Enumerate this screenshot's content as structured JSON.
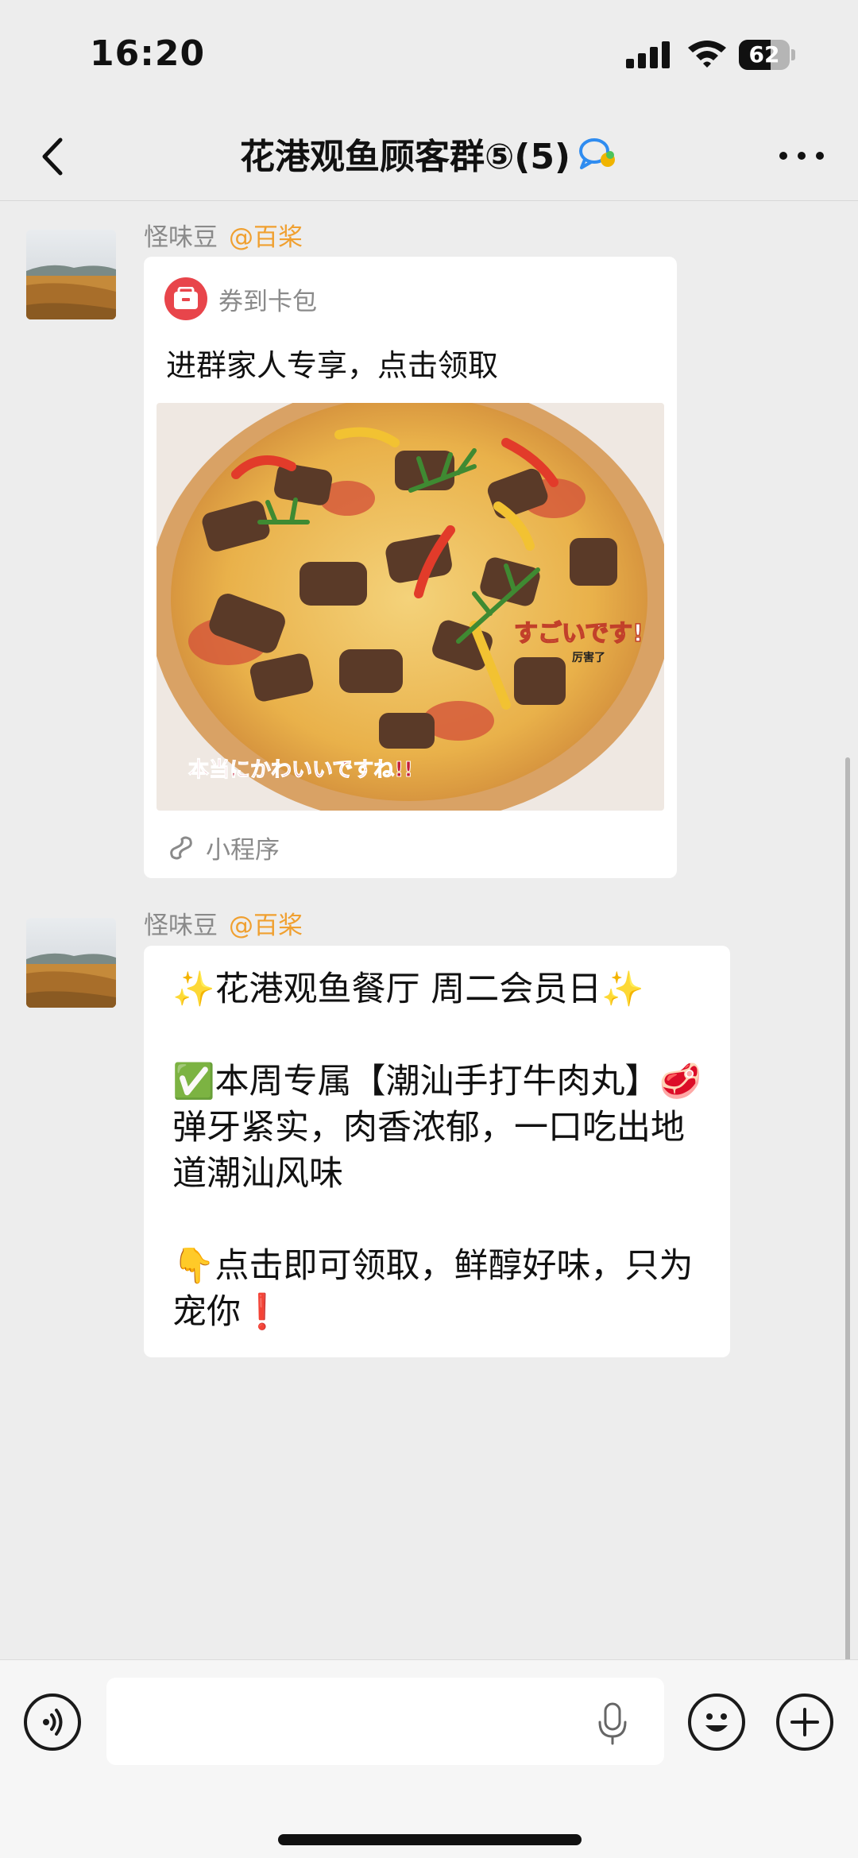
{
  "status_bar": {
    "time": "16:20",
    "battery": "62",
    "battery_level": 0.62
  },
  "nav": {
    "title": "花港观鱼顾客群⑤(5)"
  },
  "messages": [
    {
      "sender": "怪味豆",
      "mention": "@百桨",
      "card": {
        "source": "券到卡包",
        "title": "进群家人专享，点击领取",
        "image_captions": [
          "すごいです!",
          "厉害了",
          "本当にかわいいですね!!"
        ],
        "footer": "小程序"
      }
    },
    {
      "sender": "怪味豆",
      "mention": "@百桨",
      "lines": [
        "✨花港观鱼餐厅 周二会员日✨",
        "✅本周专属【潮汕手打牛肉丸】🥩弹牙紧实，肉香浓郁，一口吃出地道潮汕风味",
        "👇点击即可领取，鲜醇好味，只为宠你❗️"
      ]
    }
  ],
  "colors": {
    "accent": "#f0a030",
    "background": "#ededed",
    "card_logo": "#e8454b"
  },
  "icons": [
    "back-icon",
    "group-chat-icon",
    "more-icon",
    "voice-icon",
    "mic-icon",
    "emoji-icon",
    "plus-icon",
    "mini-program-icon"
  ]
}
